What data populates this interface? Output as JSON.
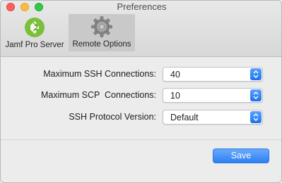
{
  "window": {
    "title": "Preferences"
  },
  "tabs": [
    {
      "label": "Jamf Pro Server",
      "icon": "jamf-logo-icon",
      "selected": false
    },
    {
      "label": "Remote Options",
      "icon": "gear-icon",
      "selected": true
    }
  ],
  "form": {
    "max_ssh": {
      "label": "Maximum SSH Connections:",
      "value": "40"
    },
    "max_scp": {
      "label": "Maximum SCP  Connections:",
      "value": "10"
    },
    "ssh_version": {
      "label": "SSH Protocol Version:",
      "value": "Default"
    }
  },
  "buttons": {
    "save_label": "Save"
  },
  "colors": {
    "accent": "#2d80f3",
    "traffic_close": "#fc605c",
    "traffic_minimize": "#fdbc40",
    "traffic_maximize": "#34c84a",
    "jamf_green": "#7bbf3a"
  }
}
